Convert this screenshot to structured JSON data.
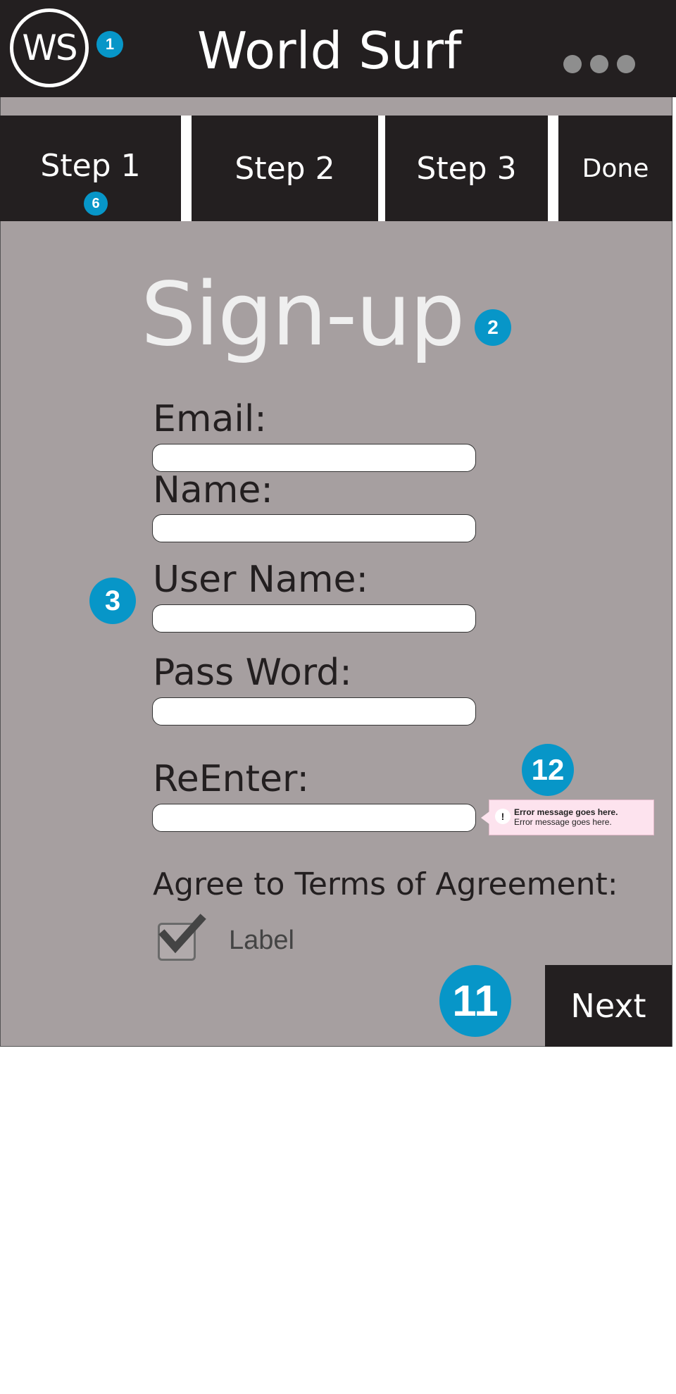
{
  "header": {
    "logo_text": "WS",
    "title": "World Surf",
    "more_icon": "more-dots-icon"
  },
  "steps": [
    {
      "label": "Step 1"
    },
    {
      "label": "Step 2"
    },
    {
      "label": "Step 3"
    },
    {
      "label": "Done"
    }
  ],
  "form": {
    "heading": "Sign-up",
    "fields": [
      {
        "label": "Email:",
        "value": ""
      },
      {
        "label": "Name:",
        "value": ""
      },
      {
        "label": "User Name:",
        "value": ""
      },
      {
        "label": "Pass Word:",
        "value": ""
      },
      {
        "label": "ReEnter:",
        "value": ""
      }
    ],
    "error": {
      "icon": "!",
      "title": "Error message goes here.",
      "body": "Error message goes here."
    },
    "agree_label": "Agree to Terms of Agreement:",
    "checkbox": {
      "label": "Label",
      "checked": true
    },
    "next_label": "Next"
  },
  "annotations": {
    "logo": "1",
    "heading": "2",
    "fields": "3",
    "step": "6",
    "next": "11",
    "error": "12"
  },
  "colors": {
    "bar": "#231f20",
    "background": "#a69fa0",
    "badge": "#0796c8",
    "error_bg": "#fde3ee"
  }
}
